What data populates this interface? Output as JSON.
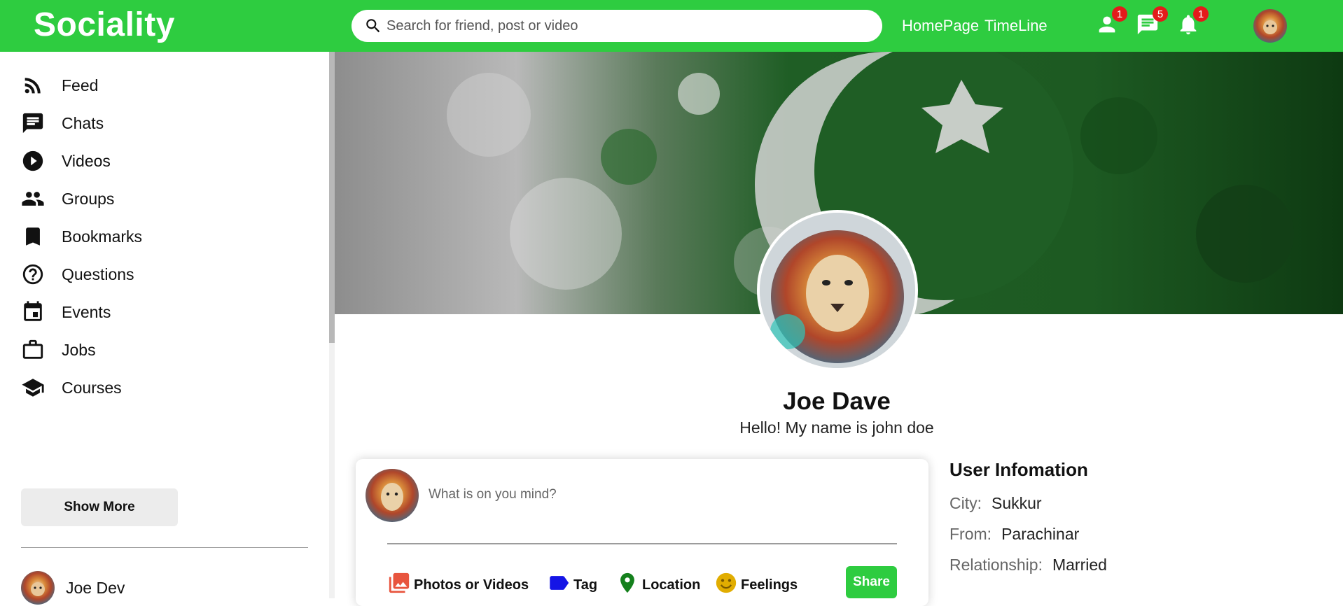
{
  "colors": {
    "brand": "#2ecc40",
    "badge": "#e31b1b"
  },
  "topbar": {
    "logo": "Sociality",
    "search_placeholder": "Search for friend, post or video",
    "links": [
      "HomePage",
      "TimeLine"
    ],
    "icons": [
      {
        "name": "person-icon",
        "badge": "1"
      },
      {
        "name": "chat-icon",
        "badge": "5"
      },
      {
        "name": "bell-icon",
        "badge": "1"
      }
    ]
  },
  "sidebar": {
    "items": [
      {
        "label": "Feed",
        "icon": "rss-icon"
      },
      {
        "label": "Chats",
        "icon": "chat-icon"
      },
      {
        "label": "Videos",
        "icon": "play-circle-icon"
      },
      {
        "label": "Groups",
        "icon": "group-icon"
      },
      {
        "label": "Bookmarks",
        "icon": "bookmark-icon"
      },
      {
        "label": "Questions",
        "icon": "help-circle-icon"
      },
      {
        "label": "Events",
        "icon": "calendar-icon"
      },
      {
        "label": "Jobs",
        "icon": "briefcase-icon"
      },
      {
        "label": "Courses",
        "icon": "school-icon"
      }
    ],
    "show_more": "Show More",
    "friends": [
      {
        "name": "Joe Dev"
      }
    ]
  },
  "profile": {
    "name": "Joe Dave",
    "description": "Hello! My name is john doe"
  },
  "share": {
    "placeholder": "What is on you mind?",
    "options": [
      {
        "label": "Photos or Videos",
        "icon": "photo-library-icon",
        "color": "#e8553e"
      },
      {
        "label": "Tag",
        "icon": "label-icon",
        "color": "#1515e6"
      },
      {
        "label": "Location",
        "icon": "location-pin-icon",
        "color": "#14801c"
      },
      {
        "label": "Feelings",
        "icon": "emoji-icon",
        "color": "#e1ad01"
      }
    ],
    "button": "Share"
  },
  "user_info": {
    "title": "User Infomation",
    "rows": [
      {
        "key": "City:",
        "value": "Sukkur"
      },
      {
        "key": "From:",
        "value": "Parachinar"
      },
      {
        "key": "Relationship:",
        "value": "Married"
      }
    ]
  }
}
